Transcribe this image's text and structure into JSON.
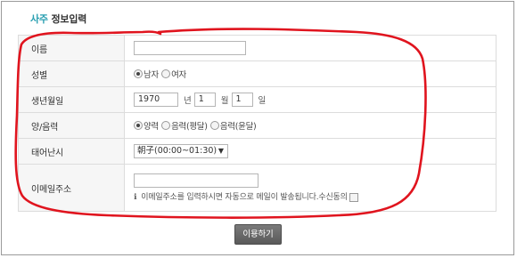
{
  "title": {
    "accent": "사주",
    "rest": "정보입력"
  },
  "rows": [
    {
      "label": "이름"
    },
    {
      "label": "성별",
      "options": [
        "남자",
        "여자"
      ],
      "selected": 0
    },
    {
      "label": "생년월일",
      "year": "1970",
      "year_unit": "년",
      "month": "1",
      "month_unit": "월",
      "day": "1",
      "day_unit": "일"
    },
    {
      "label": "양/음력",
      "options": [
        "양력",
        "음력(평달)",
        "음력(윤달)"
      ],
      "selected": 0
    },
    {
      "label": "태어난시",
      "value": "朝子(00:00~01:30)"
    },
    {
      "label": "이메일주소",
      "info_icon": "ℹ",
      "info": "이메일주소를 입력하시면 자동으로 메일이 발송됩니다.",
      "consent": "수신동의"
    }
  ],
  "submit": "이용하기",
  "colors": {
    "accent": "#2a9fb1",
    "annotation": "#e0141e",
    "button": "#666666"
  },
  "annotation": "red hand-drawn circle around the form"
}
